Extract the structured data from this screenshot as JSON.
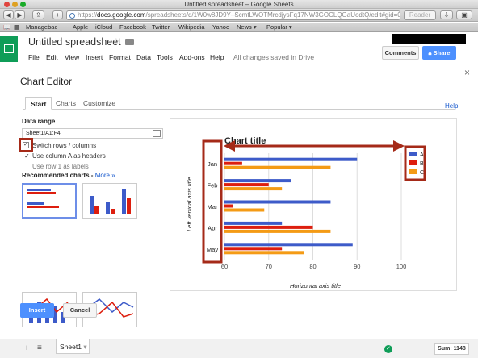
{
  "browser": {
    "window_title": "Untitled spreadsheet – Google Sheets",
    "url_prefix": "https://",
    "url_host": "docs.google.com",
    "url_path": "/spreadsheets/d/1W0w8JD9Y–ScmtLWOTMrcdjysFq17NW3GOCLQGaUodtQ/edit#gid=0",
    "reader_label": "Reader",
    "bookmarks": [
      "Managebac",
      "Apple",
      "iCloud",
      "Facebook",
      "Twitter",
      "Wikipedia",
      "Yahoo",
      "News ▾",
      "Popular ▾"
    ]
  },
  "sheets": {
    "doc_title": "Untitled spreadsheet",
    "menu": [
      "File",
      "Edit",
      "View",
      "Insert",
      "Format",
      "Data",
      "Tools",
      "Add-ons",
      "Help"
    ],
    "saved_status": "All changes saved in Drive",
    "comments_label": "Comments",
    "share_label": "Share"
  },
  "dialog": {
    "title": "Chart Editor",
    "tabs": [
      "Start",
      "Charts",
      "Customize"
    ],
    "active_tab": "Start",
    "help_label": "Help",
    "data_range_label": "Data range",
    "data_range_value": "Sheet1!A1:F4",
    "option_switch": "Switch rows / columns",
    "option_colA": "Use column A as headers",
    "option_row1": "Use row 1 as labels",
    "switch_checked": true,
    "colA_checked": true,
    "recommended_label": "Recommended charts - ",
    "more_label": "More »",
    "insert_label": "Insert",
    "cancel_label": "Cancel"
  },
  "chart_data": {
    "type": "bar",
    "orientation": "horizontal",
    "title": "Chart title",
    "xlabel": "Horizontal axis title",
    "ylabel": "Left vertical axis title",
    "categories": [
      "Jan",
      "Feb",
      "Mar",
      "Apr",
      "May"
    ],
    "xlim": [
      60,
      100
    ],
    "xticks": [
      60,
      70,
      80,
      90,
      100
    ],
    "grid": true,
    "legend_position": "right",
    "series": [
      {
        "name": "A",
        "color": "#3d5bc9",
        "values": [
          90,
          75,
          84,
          73,
          89
        ]
      },
      {
        "name": "B",
        "color": "#dd1e0e",
        "values": [
          64,
          70,
          62,
          80,
          73
        ]
      },
      {
        "name": "C",
        "color": "#f49b15",
        "values": [
          84,
          73,
          69,
          84,
          78
        ]
      }
    ]
  },
  "bottom": {
    "sheet_name": "Sheet1",
    "sum_label": "Sum: 1148"
  },
  "colors": {
    "accent_blue": "#4d90fe",
    "sheets_green": "#0f9d58",
    "annotation_red": "#a52a18"
  }
}
